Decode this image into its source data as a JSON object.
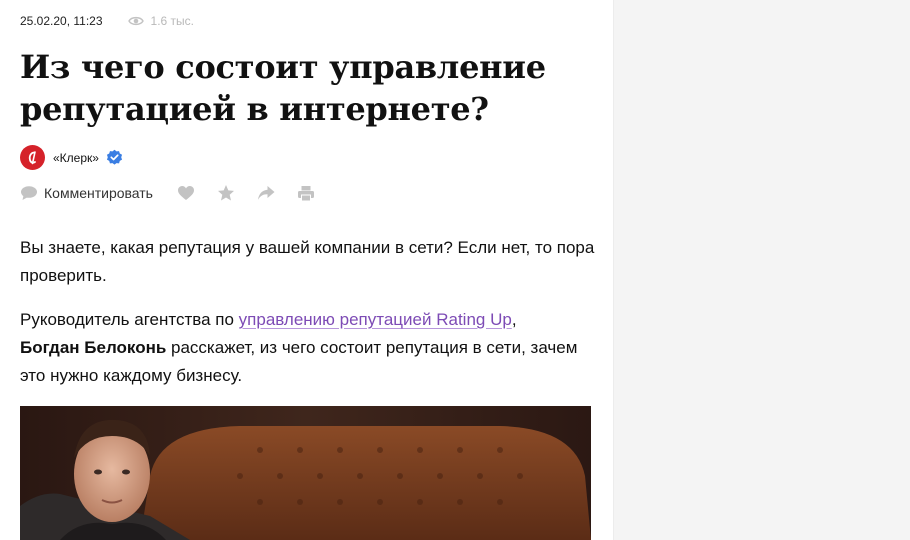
{
  "meta": {
    "date": "25.02.20, 11:23",
    "views": "1.6 тыс.",
    "views_icon": "eye-icon"
  },
  "article": {
    "title": "Из чего состоит управление репутацией в интернете?",
    "author": "«Клерк»",
    "author_avatar_icon": "klerk-logo-icon",
    "verified_icon": "verified-badge-icon",
    "actions": {
      "comment_label": "Комментировать",
      "icons": [
        "comment-icon",
        "heart-icon",
        "star-icon",
        "share-icon",
        "print-icon"
      ]
    },
    "paragraph1": "Вы знаете, какая репутация у вашей компании в сети? Если нет, то пора проверить.",
    "paragraph2": {
      "before": "Руководитель агентства по ",
      "link": "управлению репутацией Rating Up",
      "after_link": ",",
      "bold": "Богдан Белоконь",
      "rest": " расскажет, из чего состоит репутация в сети, зачем это нужно каждому бизнесу."
    }
  },
  "colors": {
    "link": "#7d4bb5",
    "brand_red": "#d5222a",
    "verified_blue": "#3a7ee3",
    "icon_gray": "#c3c3c3",
    "sidebar_bg": "#f4f4f4"
  }
}
